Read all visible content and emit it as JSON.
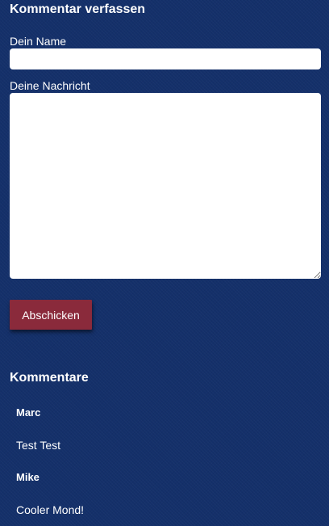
{
  "comment_form": {
    "title": "Kommentar verfassen",
    "name_label": "Dein Name",
    "name_value": "",
    "message_label": "Deine Nachricht",
    "message_value": "",
    "submit_label": "Abschicken"
  },
  "comments": {
    "title": "Kommentare",
    "items": [
      {
        "author": "Marc",
        "text": "Test Test"
      },
      {
        "author": "Mike",
        "text": "Cooler Mond!"
      }
    ]
  },
  "colors": {
    "background": "#14306a",
    "button": "#8a2a3b",
    "text": "#ffffff",
    "field": "#ffffff"
  }
}
